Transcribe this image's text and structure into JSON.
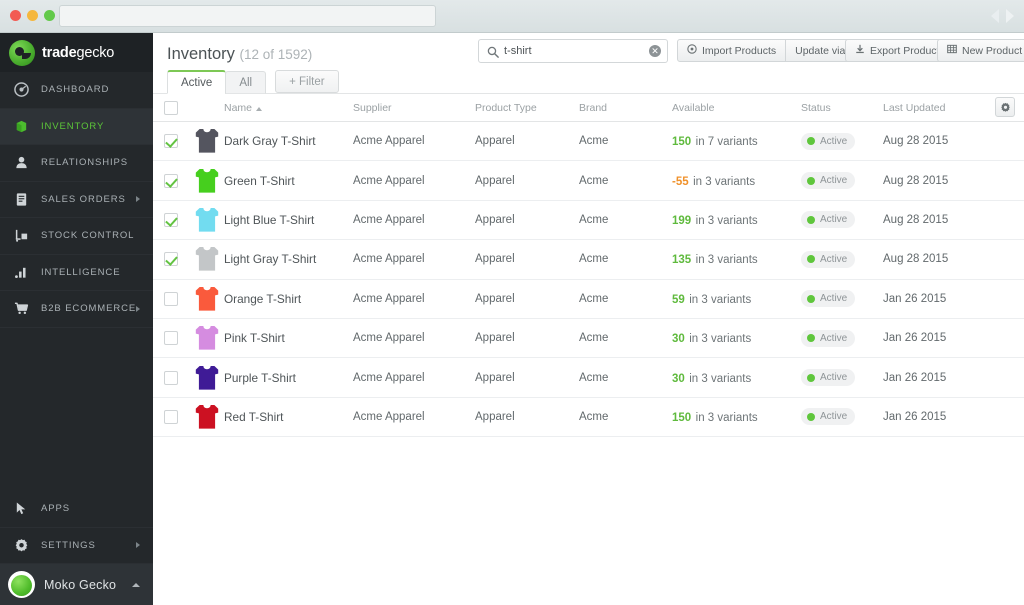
{
  "browser": {
    "traffic_lights": [
      "close",
      "minimize",
      "maximize"
    ],
    "url_value": "",
    "nav_back": "back-arrow",
    "nav_forward": "forward-arrow"
  },
  "sidebar": {
    "brand": {
      "bold": "trade",
      "light": "gecko"
    },
    "items": [
      {
        "label": "DASHBOARD",
        "icon": "dashboard-icon",
        "active": false,
        "chevron": false
      },
      {
        "label": "INVENTORY",
        "icon": "box-icon",
        "active": true,
        "chevron": false
      },
      {
        "label": "RELATIONSHIPS",
        "icon": "person-icon",
        "active": false,
        "chevron": false
      },
      {
        "label": "SALES ORDERS",
        "icon": "document-icon",
        "active": false,
        "chevron": true
      },
      {
        "label": "STOCK CONTROL",
        "icon": "forklift-icon",
        "active": false,
        "chevron": false
      },
      {
        "label": "INTELLIGENCE",
        "icon": "bar-chart-icon",
        "active": false,
        "chevron": false
      },
      {
        "label": "B2B ECOMMERCE",
        "icon": "shopping-cart-icon",
        "active": false,
        "chevron": true
      }
    ],
    "bottom_items": [
      {
        "label": "APPS",
        "icon": "cursor-icon",
        "chevron": false
      },
      {
        "label": "SETTINGS",
        "icon": "gear-icon",
        "chevron": true
      }
    ],
    "user": {
      "name": "Moko Gecko",
      "avatar": "gecko-avatar",
      "caret": "chevron-up-icon"
    },
    "accent_green": "#5cc639",
    "bg": "#24282b"
  },
  "header": {
    "title": "Inventory",
    "count": "(12 of 1592)",
    "search": {
      "value": "t-shirt",
      "placeholder": "Search",
      "icon": "search-icon",
      "clear": "✕"
    },
    "buttons": [
      {
        "label": "Import Products",
        "icon": "target-icon",
        "group": "a"
      },
      {
        "label": "Update via CSV",
        "icon": "",
        "group": "a"
      },
      {
        "label": "Export Products",
        "icon": "download-icon",
        "group": "b"
      },
      {
        "label": "New Product",
        "icon": "grid-icon",
        "group": "c"
      }
    ],
    "tabs": [
      {
        "label": "Active",
        "active": true
      },
      {
        "label": "All",
        "active": false
      }
    ],
    "filter_label": "+ Filter"
  },
  "table": {
    "columns": [
      "Name",
      "Supplier",
      "Product Type",
      "Brand",
      "Available",
      "Status",
      "Last Updated"
    ],
    "sort_column": "Name",
    "sort_dir": "asc",
    "settings_icon": "gear-icon",
    "header_checkbox_checked": false,
    "rows": [
      {
        "checked": true,
        "thumb": "#54555f",
        "name": "Dark Gray T-Shirt",
        "supplier": "Acme Apparel",
        "type": "Apparel",
        "brand": "Acme",
        "avail_num": "150",
        "avail_rest": "in 7 variants",
        "avail_color": "#5fba3d",
        "status": "Active",
        "updated": "Aug 28 2015"
      },
      {
        "checked": true,
        "thumb": "#46cf1e",
        "name": "Green T-Shirt",
        "supplier": "Acme Apparel",
        "type": "Apparel",
        "brand": "Acme",
        "avail_num": "-55",
        "avail_rest": "in 3 variants",
        "avail_color": "#f0912a",
        "status": "Active",
        "updated": "Aug 28 2015"
      },
      {
        "checked": true,
        "thumb": "#72dcf0",
        "name": "Light Blue T-Shirt",
        "supplier": "Acme Apparel",
        "type": "Apparel",
        "brand": "Acme",
        "avail_num": "199",
        "avail_rest": "in 3 variants",
        "avail_color": "#5fba3d",
        "status": "Active",
        "updated": "Aug 28 2015"
      },
      {
        "checked": true,
        "thumb": "#c3c6c8",
        "name": "Light Gray T-Shirt",
        "supplier": "Acme Apparel",
        "type": "Apparel",
        "brand": "Acme",
        "avail_num": "135",
        "avail_rest": "in 3 variants",
        "avail_color": "#5fba3d",
        "status": "Active",
        "updated": "Aug 28 2015"
      },
      {
        "checked": false,
        "thumb": "#fa5a3c",
        "name": "Orange T-Shirt",
        "supplier": "Acme Apparel",
        "type": "Apparel",
        "brand": "Acme",
        "avail_num": "59",
        "avail_rest": "in 3 variants",
        "avail_color": "#5fba3d",
        "status": "Active",
        "updated": "Jan 26 2015"
      },
      {
        "checked": false,
        "thumb": "#d58ce0",
        "name": "Pink T-Shirt",
        "supplier": "Acme Apparel",
        "type": "Apparel",
        "brand": "Acme",
        "avail_num": "30",
        "avail_rest": "in 3 variants",
        "avail_color": "#5fba3d",
        "status": "Active",
        "updated": "Jan 26 2015"
      },
      {
        "checked": false,
        "thumb": "#3f1b96",
        "name": "Purple T-Shirt",
        "supplier": "Acme Apparel",
        "type": "Apparel",
        "brand": "Acme",
        "avail_num": "30",
        "avail_rest": "in 3 variants",
        "avail_color": "#5fba3d",
        "status": "Active",
        "updated": "Jan 26 2015"
      },
      {
        "checked": false,
        "thumb": "#cc1122",
        "name": "Red T-Shirt",
        "supplier": "Acme Apparel",
        "type": "Apparel",
        "brand": "Acme",
        "avail_num": "150",
        "avail_rest": "in 3 variants",
        "avail_color": "#5fba3d",
        "status": "Active",
        "updated": "Jan 26 2015"
      }
    ]
  }
}
